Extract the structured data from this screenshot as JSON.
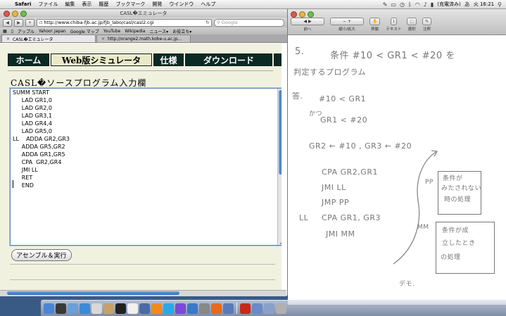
{
  "menubar": {
    "app_name": "Safari",
    "items": [
      "ファイル",
      "編集",
      "表示",
      "履歴",
      "ブックマーク",
      "開発",
      "ウインドウ",
      "ヘルプ"
    ],
    "battery": "(充電済み)",
    "clock": "火 16:21"
  },
  "safari": {
    "window_title": "CASL�エミュレータ",
    "url": "http://www.chiba-fjb.ac.jp/fjb_labo/casl/casl2.cgi",
    "search_placeholder": "Google",
    "bookmarks": [
      "アップル",
      "Yahoo! Japan",
      "Google マップ",
      "YouTube",
      "Wikipedia",
      "ニュース▾",
      "お役立ち▾"
    ],
    "tabs": [
      {
        "label": "CASL�エミュレータ",
        "active": true
      },
      {
        "label": "http://orange2.math.kobe-u.ac.jp...",
        "active": false
      }
    ]
  },
  "page": {
    "nav": [
      "ホーム",
      "Web版シミュレータ",
      "仕様",
      "ダウンロード"
    ],
    "section_title": "CASL�ソースプログラム入力欄",
    "code_lines": [
      "SUMM START",
      "     LAD GR1,0",
      "     LAD GR2,0",
      "     LAD GR3,1",
      "     LAD GR4,4",
      "     LAD GR5,0",
      "LL    ADDA GR2,GR3",
      "     ADDA GR5,GR2",
      "     ADDA GR1,GR5",
      "     CPA  GR2,GR4",
      "     JMI LL",
      "     RET",
      "     END"
    ],
    "run_button": "アセンブル＆実行"
  },
  "preview": {
    "toolbar": [
      {
        "label": "前へ",
        "icon": "◀ ▶"
      },
      {
        "label": "縮小/拡大",
        "icon": "− +"
      },
      {
        "label": "移動",
        "icon": "✋"
      },
      {
        "label": "テキスト",
        "icon": "I"
      },
      {
        "label": "選択",
        "icon": "⬚"
      },
      {
        "label": "注釈",
        "icon": "✎"
      }
    ],
    "notes": {
      "number": "5.",
      "problem_1": "条件 #10 < GR1 < #20 を",
      "problem_2": "判定するプログラム",
      "answer_label": "答.",
      "cond_1": "#10 < GR1",
      "katsu": "かつ",
      "cond_2": "GR1 < #20",
      "assign": "GR2 ← #10 , GR3 ← #20",
      "asm_1": "CPA  GR2,GR1",
      "asm_2": "JMI   LL",
      "asm_3": "JMP   PP",
      "asm_4_label": "LL",
      "asm_4": "CPA   GR1, GR3",
      "asm_5": "JMI   MM",
      "pp_label": "PP",
      "pp_box": [
        "条件が",
        "みたされない",
        "時の処理"
      ],
      "mm_label": "MM",
      "mm_box": [
        "条件が成",
        "立したとき",
        "の処理"
      ],
      "demo": "デモ."
    }
  },
  "dock": {
    "icons": [
      "finder-icon",
      "dashboard-icon",
      "mail-icon",
      "safari-icon",
      "ical-icon",
      "addressbook-icon",
      "terminal-icon",
      "textedit-icon",
      "preview-icon",
      "vlc-icon",
      "skype-icon",
      "itunes-icon",
      "iphoto-icon",
      "sysprefs-icon",
      "firefox-icon",
      "preview2-icon",
      "acrobat-icon",
      "folder-icon",
      "downloads-icon",
      "trash-icon"
    ],
    "colors": [
      "#4a86d6",
      "#3a3a3a",
      "#6a9fd8",
      "#3b8ad8",
      "#d8d8d8",
      "#c8a06a",
      "#222222",
      "#f0f0f0",
      "#4a6aa8",
      "#f08a1a",
      "#2aa8e8",
      "#7a4ad8",
      "#3a78c8",
      "#888888",
      "#e86a1a",
      "#5a7ab8",
      "#c8281a",
      "#6a8ac8",
      "#8aa0c8",
      "#b0b0b0"
    ]
  }
}
